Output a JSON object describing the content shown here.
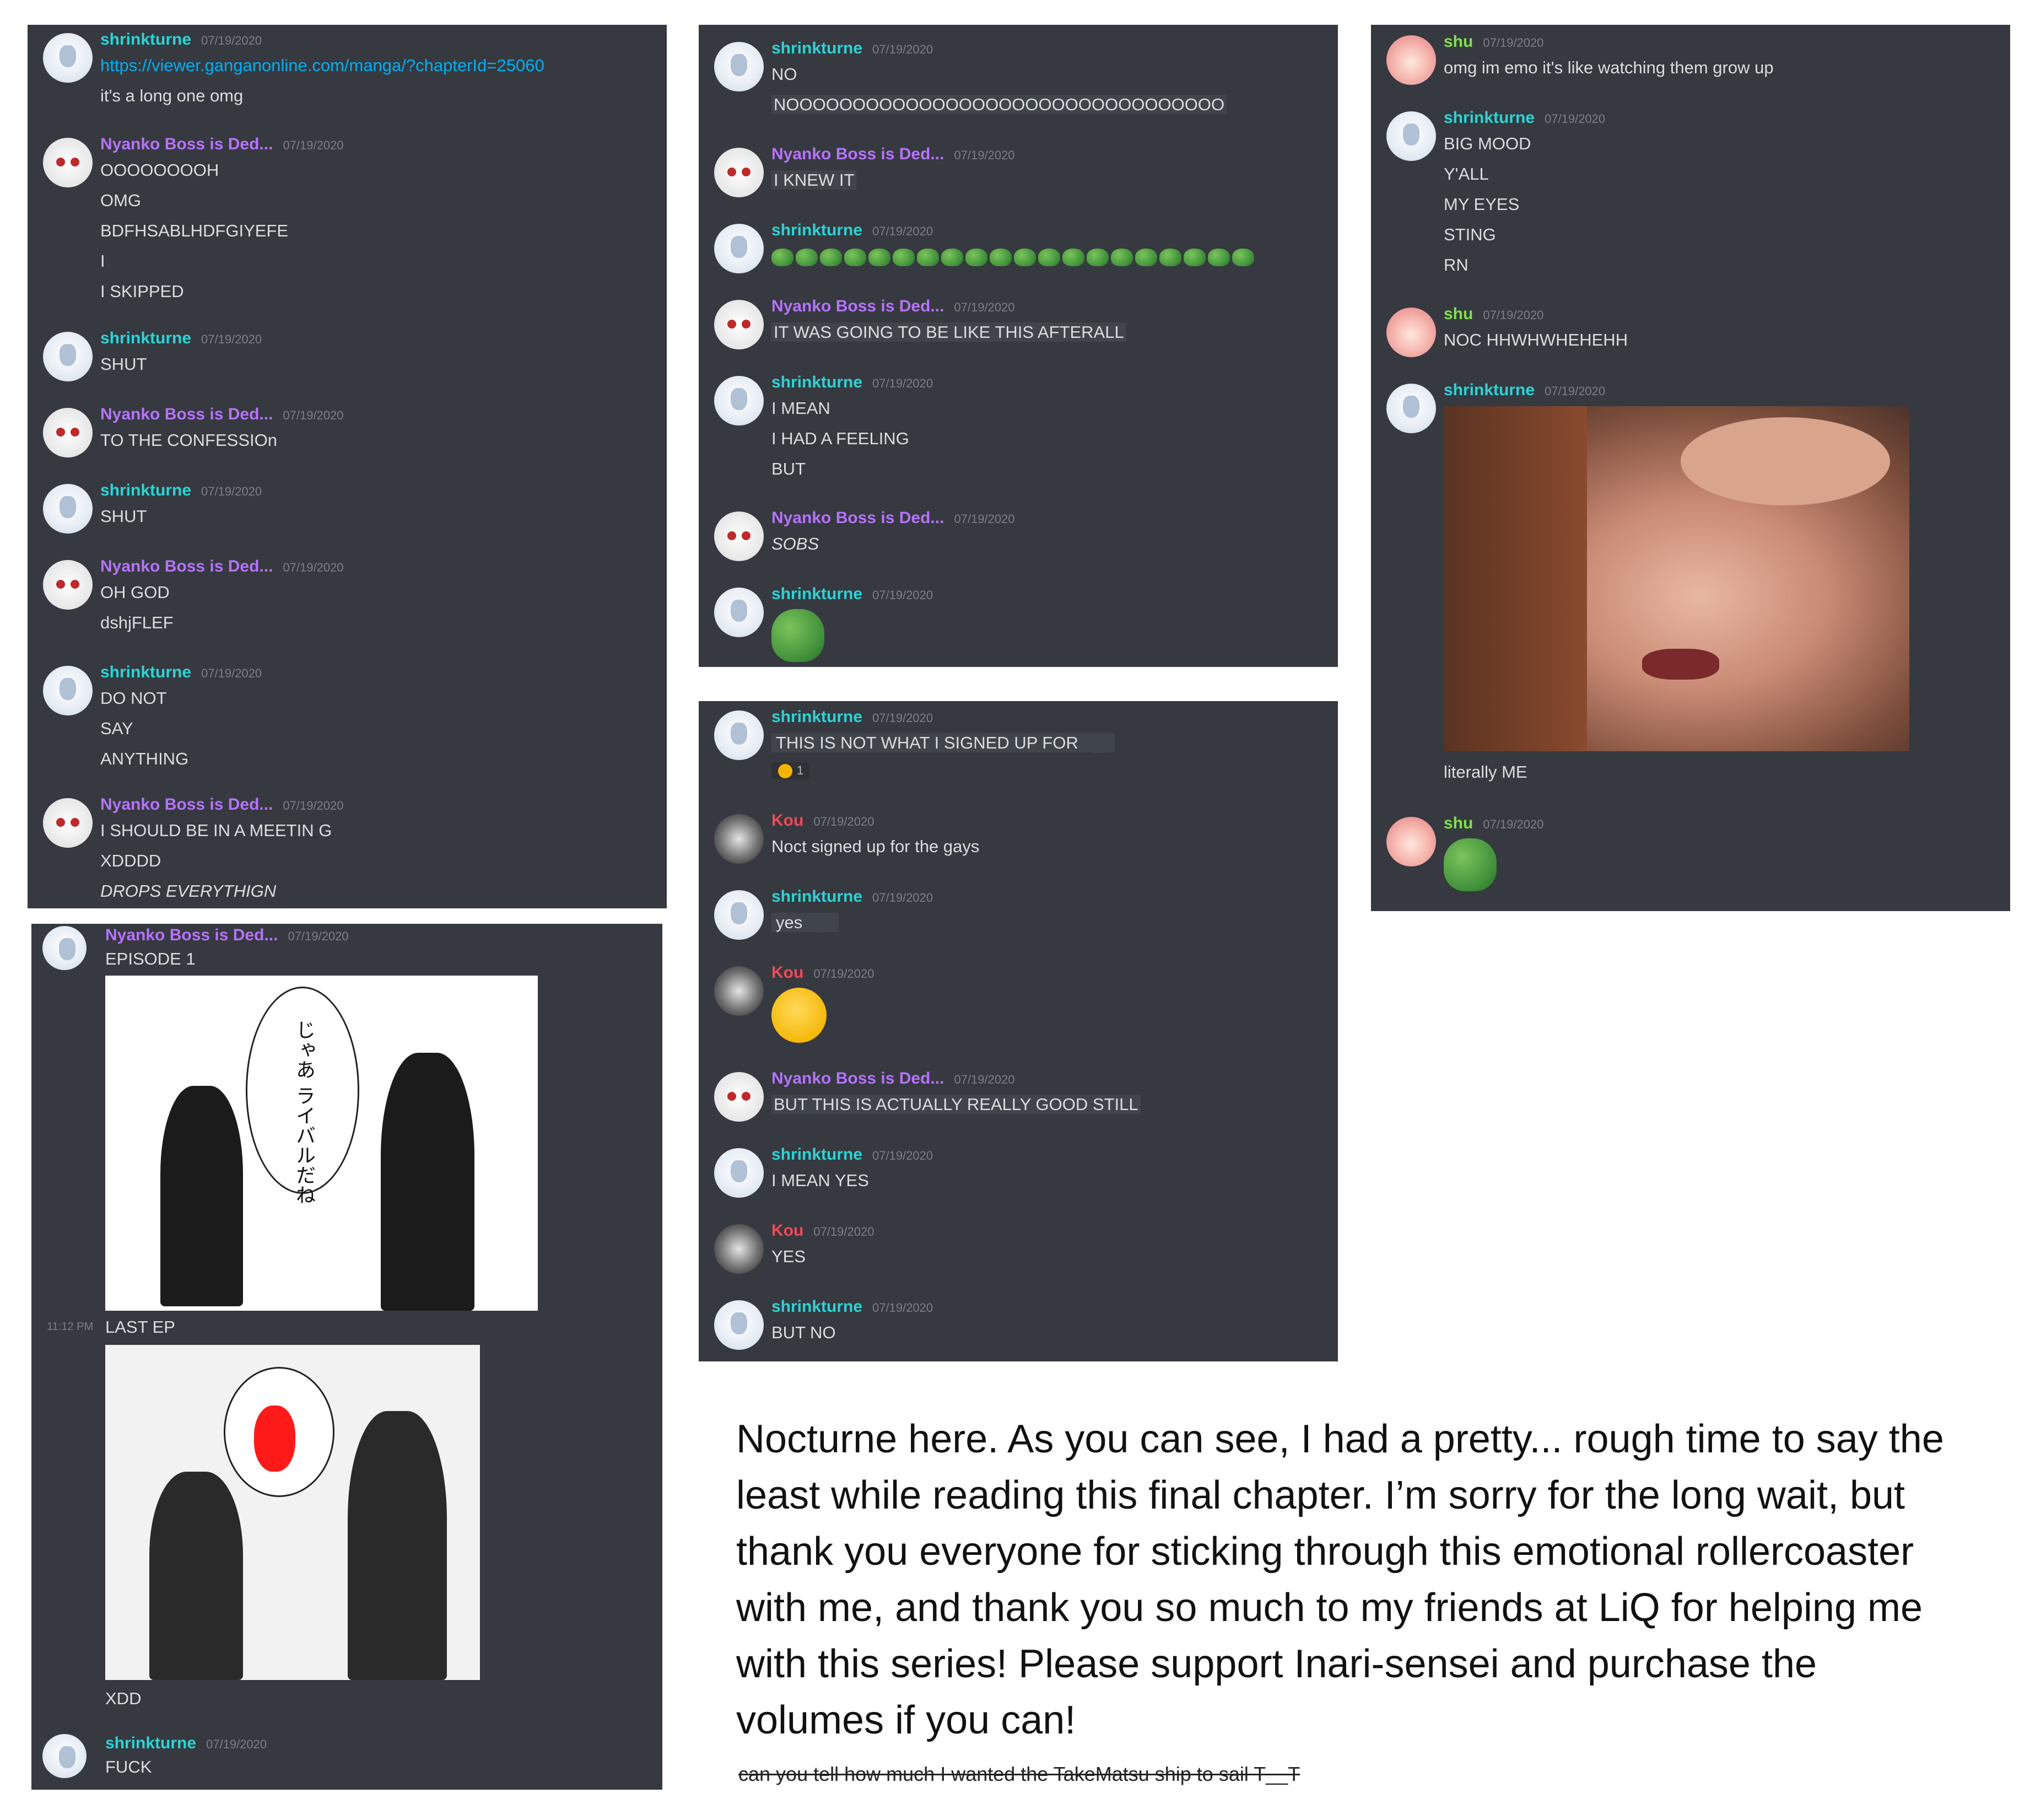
{
  "users": {
    "shrinkturne": "shrinkturne",
    "nyanko": "Nyanko Boss is Ded...",
    "shu": "shu",
    "kou": "Kou"
  },
  "date": "07/19/2020",
  "panel1": {
    "link": "https://viewer.ganganonline.com/manga/?chapterId=25060",
    "l1": "it's a long one omg",
    "m2": [
      "OOOOOOOOH",
      "OMG",
      "BDFHSABLHDFGIYEFE",
      "I",
      "I SKIPPED"
    ],
    "m3": "SHUT",
    "m4": "TO THE CONFESSIOn",
    "m5": "SHUT",
    "m6": [
      "OH GOD",
      "dshjFLEF"
    ],
    "m7": [
      "DO NOT",
      "SAY",
      "ANYTHING"
    ],
    "m8": [
      "I SHOULD BE IN A MEETIN G",
      "XDDDD",
      "DROPS EVERYTHIGN"
    ]
  },
  "panel2": {
    "episode": "EPISODE 1",
    "time": "11:12 PM",
    "last": "LAST EP",
    "manga_text": "じゃあ ライバルだね",
    "xdd": "XDD",
    "fuck": "FUCK"
  },
  "panel3": {
    "m1": [
      "NO",
      "NOOOOOOOOOOOOOOOOOOOOOOOOOOOOOOOOO"
    ],
    "m2": "I KNEW IT",
    "m4": "IT WAS GOING TO BE LIKE THIS AFTERALL",
    "m5": [
      "I MEAN",
      "I HAD A FEELING",
      "BUT"
    ],
    "m6": "SOBS"
  },
  "panel4": {
    "m1": "THIS IS NOT WHAT I SIGNED UP FOR",
    "reaction_count": "1",
    "m2": "Noct signed up for the gays",
    "m3": "yes",
    "m5": "BUT THIS IS ACTUALLY REALLY GOOD STILL",
    "m6": "I MEAN YES",
    "m7": "YES",
    "m8": "BUT NO"
  },
  "panel5": {
    "m1": "omg im emo it's like watching them grow up",
    "m2": [
      "BIG MOOD",
      "Y'ALL",
      "MY EYES",
      "STING",
      "RN"
    ],
    "m3": "NOC HHWHWHEHEHH",
    "caption": "literally ME"
  },
  "footer": {
    "text": "Nocturne here. As you can see, I had a pretty... rough time to say the least while reading this final chapter. I’m sorry for the long wait, but thank you everyone for sticking through this emotional rollercoaster with me, and thank you so much to my friends at LiQ for helping me with this series! Please support Inari-sensei and purchase the volumes if you can!",
    "note": "can you tell how much I wanted the TakeMatsu ship to sail T__T"
  }
}
